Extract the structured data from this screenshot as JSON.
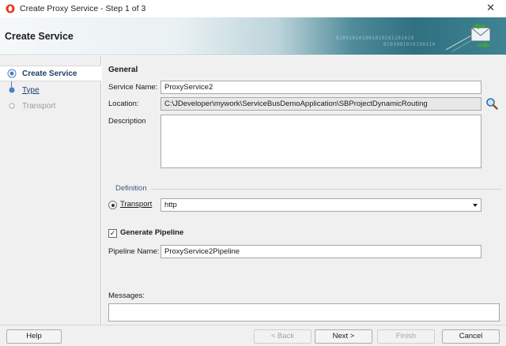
{
  "window": {
    "title": "Create Proxy Service - Step 1 of 3",
    "close_glyph": "✕"
  },
  "banner": {
    "heading": "Create Service",
    "binary_1": "010010101001010101101010",
    "binary_2": "0101001010100110"
  },
  "steps": [
    {
      "label": "Create Service",
      "state": "active"
    },
    {
      "label": "Type",
      "state": "link"
    },
    {
      "label": "Transport",
      "state": "disabled"
    }
  ],
  "general": {
    "title": "General",
    "service_name_label": "Service Name:",
    "service_name_value": "ProxyService2",
    "location_label": "Location:",
    "location_value": "C:\\JDeveloper\\mywork\\ServiceBusDemoApplication\\SBProjectDynamicRouting",
    "description_label": "Description",
    "description_value": ""
  },
  "definition": {
    "title": "Definition",
    "transport_label": "Transport",
    "transport_value": "http",
    "transport_selected": true
  },
  "pipeline": {
    "generate_label": "Generate Pipeline",
    "generate_checked": true,
    "check_glyph": "✓",
    "name_label": "Pipeline Name:",
    "name_value": "ProxyService2Pipeline"
  },
  "messages": {
    "label": "Messages:",
    "value": ""
  },
  "buttons": {
    "help": "Help",
    "back": "< Back",
    "next": "Next >",
    "finish": "Finish",
    "cancel": "Cancel"
  },
  "icons": {
    "app": "oracle-icon",
    "search": "search-icon",
    "banner_graphic": "envelope-arrows-icon"
  }
}
